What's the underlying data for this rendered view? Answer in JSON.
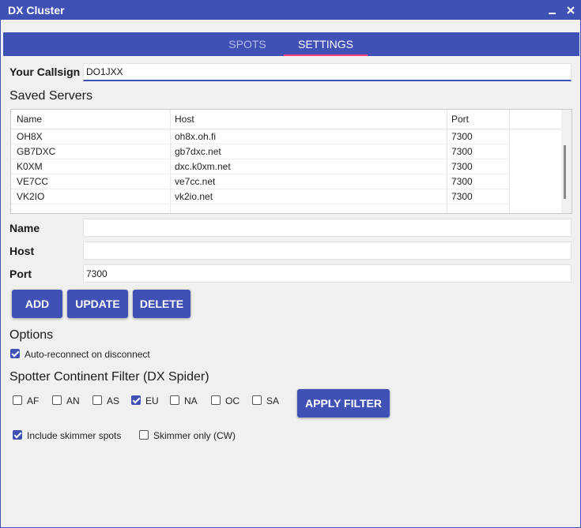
{
  "window": {
    "title": "DX Cluster"
  },
  "tabs": [
    {
      "label": "SPOTS"
    },
    {
      "label": "SETTINGS"
    }
  ],
  "callsign": {
    "label": "Your Callsign",
    "value": "DO1JXX"
  },
  "servers": {
    "heading": "Saved Servers",
    "columns": [
      "Name",
      "Host",
      "Port"
    ],
    "rows": [
      [
        "OH8X",
        "oh8x.oh.fi",
        "7300"
      ],
      [
        "GB7DXC",
        "gb7dxc.net",
        "7300"
      ],
      [
        "K0XM",
        "dxc.k0xm.net",
        "7300"
      ],
      [
        "VE7CC",
        "ve7cc.net",
        "7300"
      ],
      [
        "VK2IO",
        "vk2io.net",
        "7300"
      ]
    ]
  },
  "form": {
    "name_label": "Name",
    "name_value": "",
    "host_label": "Host",
    "host_value": "",
    "port_label": "Port",
    "port_value": "7300"
  },
  "buttons": {
    "add": "ADD",
    "update": "UPDATE",
    "delete": "DELETE",
    "apply_filter": "APPLY FILTER"
  },
  "options": {
    "heading": "Options",
    "auto_reconnect_label": "Auto-reconnect on disconnect",
    "auto_reconnect_checked": true
  },
  "filter": {
    "heading": "Spotter Continent Filter (DX Spider)",
    "continents": [
      {
        "label": "AF",
        "checked": false
      },
      {
        "label": "AN",
        "checked": false
      },
      {
        "label": "AS",
        "checked": false
      },
      {
        "label": "EU",
        "checked": true
      },
      {
        "label": "NA",
        "checked": false
      },
      {
        "label": "OC",
        "checked": false
      },
      {
        "label": "SA",
        "checked": false
      }
    ]
  },
  "skimmer": {
    "include_label": "Include skimmer spots",
    "include_checked": true,
    "only_label": "Skimmer only (CW)",
    "only_checked": false
  },
  "colors": {
    "accent": "#3f51b5",
    "tab_indicator": "#ff4081"
  }
}
